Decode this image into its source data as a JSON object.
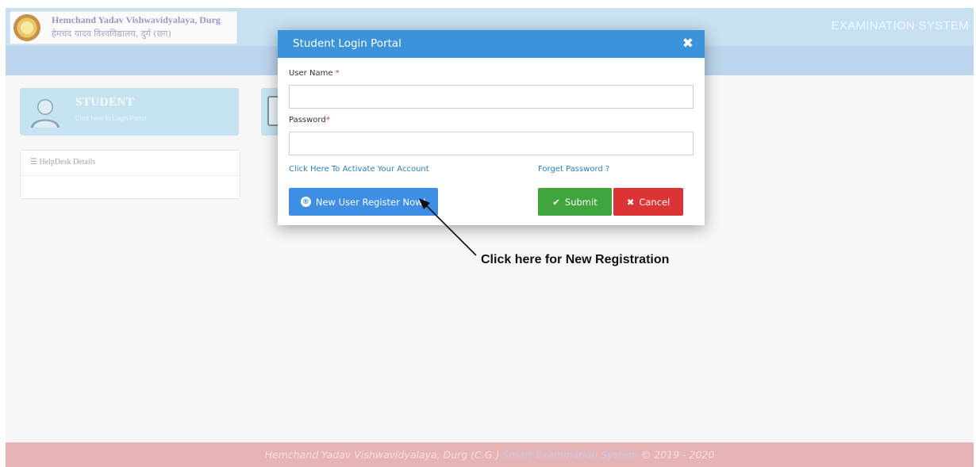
{
  "header": {
    "university_en": "Hemchand Yadav Vishwavidyalaya, Durg",
    "university_hi": "हेमचंद यादव विश्वविद्यालय, दुर्ग (छग)",
    "system_title": "EXAMINATION SYSTEM"
  },
  "student_card": {
    "title": "STUDENT",
    "subtitle": "Click here to Login Portal"
  },
  "helpdesk": {
    "title": "HelpDesk Details",
    "icon": "list-icon"
  },
  "modal": {
    "title": "Student Login Portal",
    "close_icon": "close-icon",
    "username_label": "User Name ",
    "password_label": "Password",
    "required_mark": "*",
    "username_value": "",
    "password_value": "",
    "activate_link": "Click Here To Activate Your Account",
    "forget_link": "Forget Password ?",
    "register_icon": "®",
    "register_label": "New User Register Now!",
    "submit_label": "Submit",
    "cancel_label": "Cancel"
  },
  "annotation": {
    "text": "Click here for New Registration"
  },
  "footer": {
    "text_main": "Hemchand Yadav Vishwavidyalaya, Durg (C.G.) ",
    "text_accent": "Smart Examination System",
    "text_end": " © 2019 - 2020"
  },
  "colors": {
    "modal_header": "#3b94db",
    "register_button": "#3f8ee6",
    "submit_button": "#3fa53c",
    "cancel_button": "#dc3434",
    "footer_bg": "#e6b4b4"
  }
}
